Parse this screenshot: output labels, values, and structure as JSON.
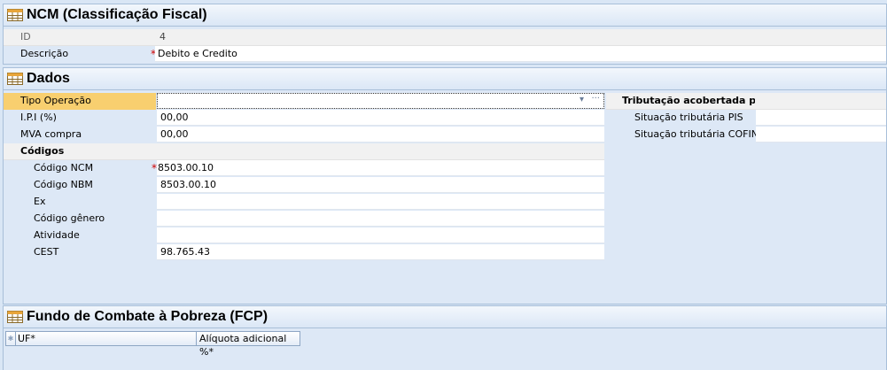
{
  "section_ncm": {
    "title": "NCM (Classificação Fiscal)",
    "id_label": "ID",
    "id_value": "4",
    "descricao_label": "Descrição",
    "descricao_value": "Debito e Credito",
    "required_mark": "*"
  },
  "section_dados": {
    "title": "Dados",
    "tipo_operacao_label": "Tipo Operação",
    "tipo_operacao_value": "",
    "ipi_label": "I.P.I (%)",
    "ipi_value": "00,00",
    "mva_label": "MVA compra",
    "mva_value": "00,00",
    "codigos_label": "Códigos",
    "codigo_ncm_label": "Código NCM",
    "codigo_ncm_value": "8503.00.10",
    "codigo_nbm_label": "Código NBM",
    "codigo_nbm_value": "8503.00.10",
    "ex_label": "Ex",
    "ex_value": "",
    "codigo_genero_label": "Código  gênero",
    "codigo_genero_value": "",
    "atividade_label": "Atividade",
    "atividade_value": "",
    "cest_label": "CEST",
    "cest_value": "98.765.43",
    "tributacao_label": "Tributação acobertada poi",
    "pis_label": "Situação tributária PIS",
    "pis_value": "",
    "cofins_label": "Situação tributária COFINS",
    "cofins_value": "",
    "ellipsis": "···",
    "dropdown_arrow": "▾"
  },
  "section_fcp": {
    "title": "Fundo de Combate à Pobreza (FCP)",
    "col_uf": "UF*",
    "col_aliquota": "Alíquota adicional %*",
    "new_row_marker": "✱"
  },
  "colors": {
    "accent_row": "#f8cf6f",
    "panel_bg": "#dde8f6",
    "required": "#d00000"
  }
}
